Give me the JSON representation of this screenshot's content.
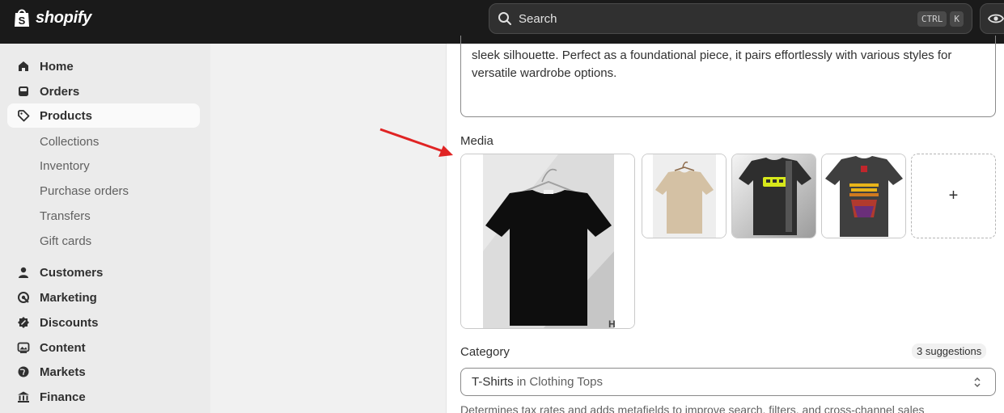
{
  "brand": {
    "name": "shopify"
  },
  "search": {
    "label": "Search",
    "shortcut_key1": "CTRL",
    "shortcut_key2": "K"
  },
  "sidebar": {
    "items": [
      {
        "label": "Home",
        "icon": "home-icon"
      },
      {
        "label": "Orders",
        "icon": "orders-icon"
      },
      {
        "label": "Products",
        "icon": "tag-icon",
        "active": true
      },
      {
        "label": "Customers",
        "icon": "person-icon"
      },
      {
        "label": "Marketing",
        "icon": "target-icon"
      },
      {
        "label": "Discounts",
        "icon": "discount-icon"
      },
      {
        "label": "Content",
        "icon": "content-icon"
      },
      {
        "label": "Markets",
        "icon": "globe-icon"
      },
      {
        "label": "Finance",
        "icon": "bank-icon"
      }
    ],
    "product_subitems": [
      "Collections",
      "Inventory",
      "Purchase orders",
      "Transfers",
      "Gift cards"
    ]
  },
  "product": {
    "description_tail": "sleek silhouette. Perfect as a foundational piece, it pairs effortlessly with various styles for versatile wardrobe options.",
    "media_label": "Media",
    "add_media_symbol": "+",
    "category_label": "Category",
    "suggestions": "3 suggestions",
    "category_main": "T-Shirts",
    "category_connector": "in",
    "category_parent": "Clothing Tops",
    "category_helper": "Determines tax rates and adds metafields to improve search, filters, and cross-channel sales"
  },
  "colors": {
    "topbar": "#1a1a1a",
    "annotation_arrow": "#e02424"
  }
}
